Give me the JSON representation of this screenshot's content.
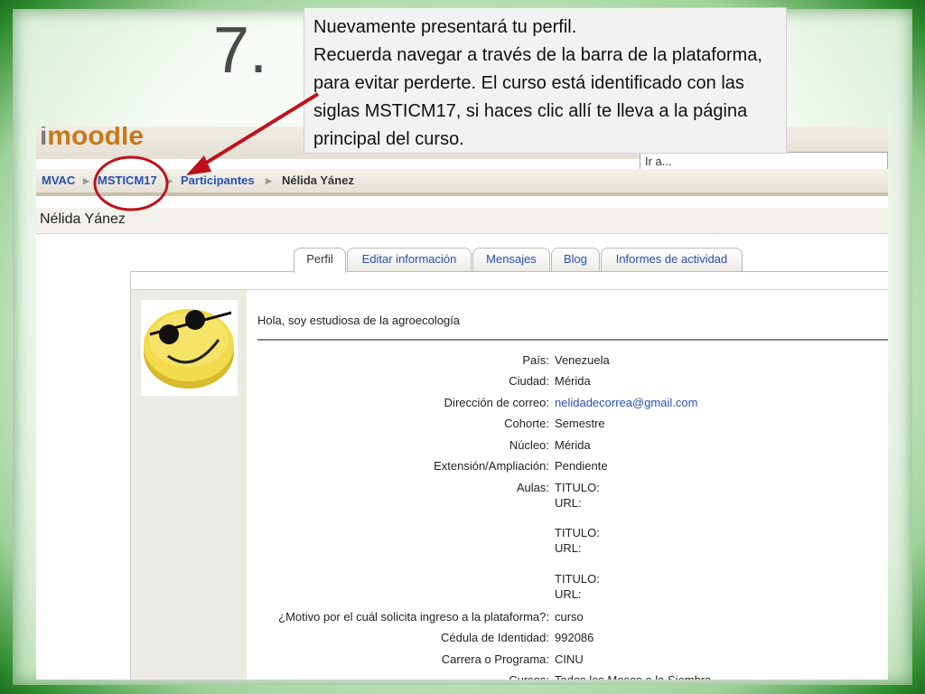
{
  "slide": {
    "step_number": "7.",
    "callout_line1": "Nuevamente presentará tu perfil.",
    "callout_line2": "Recuerda  navegar a través de la barra de la plataforma, para evitar perderte. El curso está identificado con las siglas MSTICM17, si haces clic allí te lleva a la página principal del curso.",
    "colors": {
      "frame": "#2c8a2c",
      "annotation": "#c0111a"
    }
  },
  "moodle": {
    "logo": "moodle",
    "jump_select": "Ir a...",
    "breadcrumb": [
      "MVAC",
      "MSTICM17",
      "Participantes",
      "Nélida Yánez"
    ],
    "page_title": "Nélida Yánez",
    "tabs": [
      "Perfil",
      "Editar información",
      "Mensajes",
      "Blog",
      "Informes de actividad"
    ],
    "description": "Hola, soy estudiosa de la agroecología",
    "fields": [
      {
        "label": "País:",
        "value": "Venezuela"
      },
      {
        "label": "Ciudad:",
        "value": "Mérida"
      },
      {
        "label": "Dirección de correo:",
        "value": "nelidadecorrea@gmail.com"
      },
      {
        "label": "Cohorte:",
        "value": "Semestre"
      },
      {
        "label": "Núcleo:",
        "value": "Mérida"
      },
      {
        "label": "Extensión/Ampliación:",
        "value": "Pendiente"
      },
      {
        "label": "Aulas:",
        "value": "TITULO:"
      },
      {
        "label": "",
        "value": "URL:"
      },
      {
        "label": "",
        "value": "TITULO:"
      },
      {
        "label": "",
        "value": "URL:"
      },
      {
        "label": "",
        "value": "TITULO:"
      },
      {
        "label": "",
        "value": "URL:"
      },
      {
        "label": "¿Motivo por el cuál solicita ingreso a la plataforma?:",
        "value": "curso"
      },
      {
        "label": "Cédula de Identidad:",
        "value": "992086"
      },
      {
        "label": "Carrera o Programa:",
        "value": "CINU"
      },
      {
        "label": "Cursos:",
        "value": "Todos los Meses a la Siembra"
      }
    ]
  }
}
